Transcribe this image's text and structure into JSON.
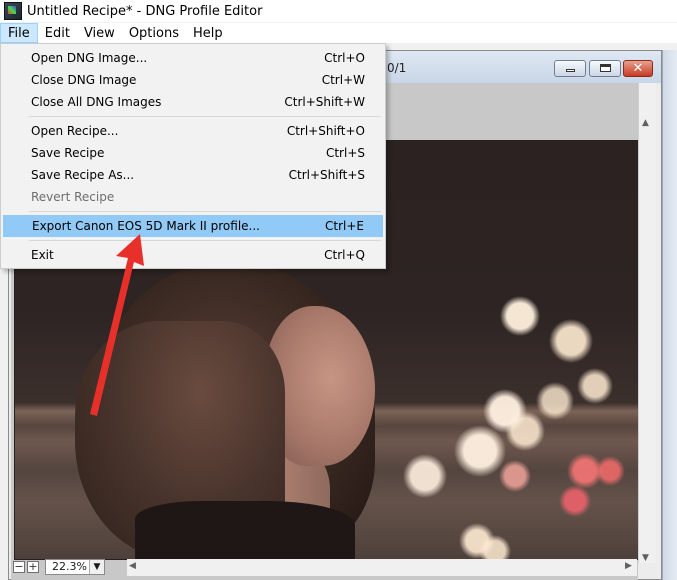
{
  "window": {
    "title": "Untitled Recipe* - DNG Profile Editor"
  },
  "menubar": {
    "items": [
      {
        "label": "File",
        "active": true
      },
      {
        "label": "Edit"
      },
      {
        "label": "View"
      },
      {
        "label": "Options"
      },
      {
        "label": "Help"
      }
    ]
  },
  "file_menu": {
    "items": [
      {
        "label": "Open DNG Image...",
        "shortcut": "Ctrl+O"
      },
      {
        "label": "Close DNG Image",
        "shortcut": "Ctrl+W"
      },
      {
        "label": "Close All DNG Images",
        "shortcut": "Ctrl+Shift+W"
      },
      {
        "label": "Open Recipe...",
        "shortcut": "Ctrl+Shift+O"
      },
      {
        "label": "Save Recipe",
        "shortcut": "Ctrl+S"
      },
      {
        "label": "Save Recipe As...",
        "shortcut": "Ctrl+Shift+S"
      },
      {
        "label": "Revert Recipe",
        "shortcut": "",
        "disabled": true
      },
      {
        "label": "Export Canon EOS 5D Mark II profile...",
        "shortcut": "Ctrl+E",
        "highlighted": true
      },
      {
        "label": "Exit",
        "shortcut": "Ctrl+Q"
      }
    ]
  },
  "document": {
    "title_fragment": "0/1",
    "zoom_level": "22.3%",
    "zoom_minus": "−",
    "zoom_plus": "+"
  },
  "icons": {
    "app": "dng-profile-editor-icon",
    "minimize": "minimize-icon",
    "maximize": "maximize-icon",
    "close": "close-icon",
    "dropdown": "chevron-down-icon"
  },
  "colors": {
    "menu_highlight": "#91c9f7",
    "menu_active": "#cce8ff",
    "annotation_arrow": "#e8302a"
  }
}
